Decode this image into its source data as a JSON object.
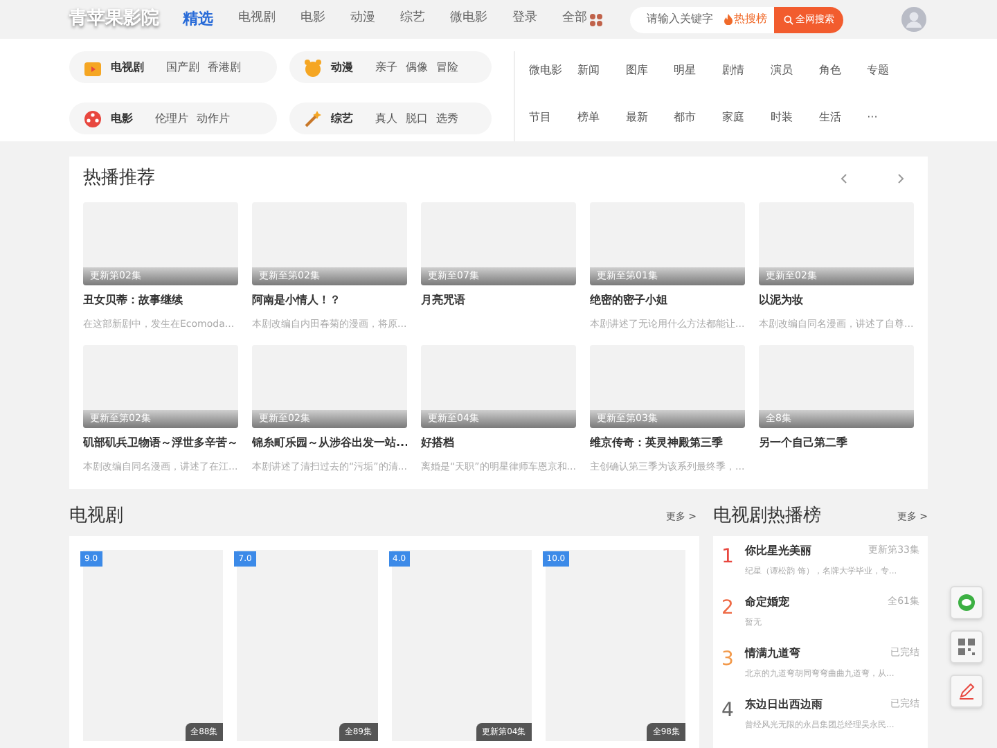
{
  "header": {
    "logo": "青苹果影院",
    "nav": [
      {
        "label": "精选",
        "selected": true
      },
      {
        "label": "电视剧",
        "selected": false
      },
      {
        "label": "电影",
        "selected": false
      },
      {
        "label": "动漫",
        "selected": false
      },
      {
        "label": "综艺",
        "selected": false
      },
      {
        "label": "微电影",
        "selected": false
      },
      {
        "label": "登录",
        "selected": false
      },
      {
        "label": "全部",
        "selected": false
      }
    ],
    "search": {
      "placeholder": "请输入关键字",
      "hot": "热搜榜",
      "button": "全网搜索"
    }
  },
  "categories": [
    {
      "kind": "tv",
      "title": "电视剧",
      "links": [
        "国产剧",
        "香港剧"
      ]
    },
    {
      "kind": "anime",
      "title": "动漫",
      "links": [
        "亲子",
        "偶像",
        "冒险"
      ]
    },
    {
      "kind": "movie",
      "title": "电影",
      "links": [
        "伦理片",
        "动作片"
      ]
    },
    {
      "kind": "variety",
      "title": "综艺",
      "links": [
        "真人",
        "脱口",
        "选秀"
      ]
    }
  ],
  "tags": [
    "微电影",
    "新闻",
    "图库",
    "明星",
    "剧情",
    "演员",
    "角色",
    "专题",
    "节目",
    "榜单",
    "最新",
    "都市",
    "家庭",
    "时装",
    "生活",
    "···"
  ],
  "hot": {
    "title": "热播推荐",
    "items": [
      {
        "status": "更新第02集",
        "title": "丑女贝蒂：故事继续",
        "desc": "在这部新剧中，发生在Ecomoda..."
      },
      {
        "status": "更新至第02集",
        "title": "阿南是小情人！？",
        "desc": "本剧改编自内田春菊的漫画，将原..."
      },
      {
        "status": "更新至07集",
        "title": "月亮咒语"
      },
      {
        "status": "更新至第01集",
        "title": "绝密的密子小姐",
        "desc": "本剧讲述了无论用什么方法都能让..."
      },
      {
        "status": "更新至02集",
        "title": "以泥为妆",
        "desc": "本剧改编自同名漫画，讲述了自尊..."
      },
      {
        "status": "更新至第02集",
        "title": "矶部矶兵卫物语～浮世多辛苦～",
        "desc": "本剧改编自同名漫画，讲述了在江..."
      },
      {
        "status": "更新至02集",
        "title": "锦糸町乐园～从涉谷出发一站...",
        "desc": "本剧讲述了清扫过去的“污垢”的清..."
      },
      {
        "status": "更新至04集",
        "title": "好搭档",
        "desc": "离婚是“天职”的明星律师车恩京和..."
      },
      {
        "status": "更新至第03集",
        "title": "维京传奇：英灵神殿第三季",
        "desc": "主创确认第三季为该系列最终季，..."
      },
      {
        "status": "全8集",
        "title": "另一个自己第二季"
      }
    ]
  },
  "tv": {
    "title": "电视剧",
    "more": "更多 >",
    "items": [
      {
        "score": "9.0",
        "status": "全88集"
      },
      {
        "score": "7.0",
        "status": "全89集"
      },
      {
        "score": "4.0",
        "status": "更新第04集"
      },
      {
        "score": "10.0",
        "status": "全98集"
      }
    ]
  },
  "ranking": {
    "title": "电视剧热播榜",
    "more": "更多 >",
    "items": [
      {
        "rank": "1",
        "color": "#e8473f",
        "title": "你比星光美丽",
        "status": "更新第33集",
        "desc": "纪星（谭松韵 饰），名牌大学毕业，专..."
      },
      {
        "rank": "2",
        "color": "#ee6a45",
        "title": "命定婚宠",
        "status": "全61集",
        "desc": "暂无"
      },
      {
        "rank": "3",
        "color": "#f2994a",
        "title": "情满九道弯",
        "status": "已完结",
        "desc": "北京的九道弯胡同弯弯曲曲九道弯，从..."
      },
      {
        "rank": "4",
        "color": "#666666",
        "title": "东边日出西边雨",
        "status": "已完结",
        "desc": "曾经风光无限的永昌集团总经理吴永民..."
      }
    ]
  },
  "side": [
    {
      "kind": "wechat"
    },
    {
      "kind": "qr"
    },
    {
      "kind": "edit"
    }
  ]
}
